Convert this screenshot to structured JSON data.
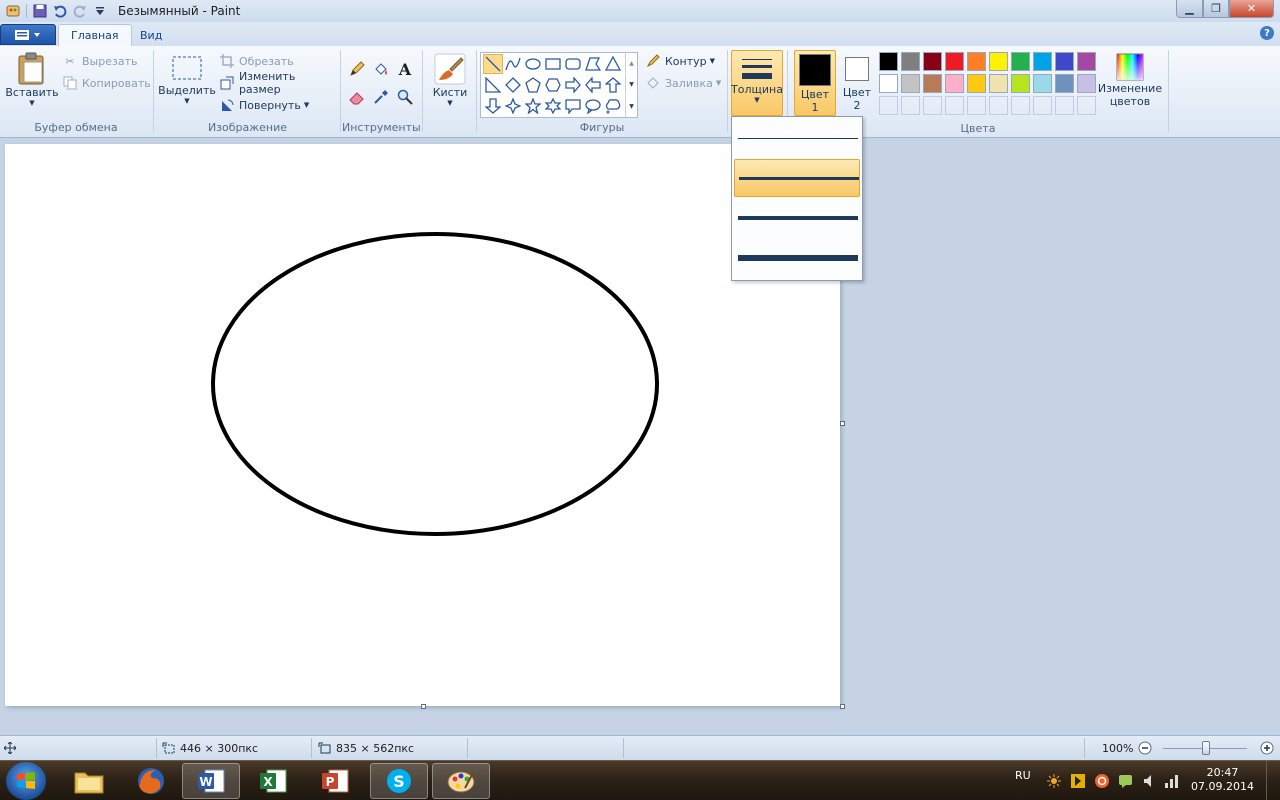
{
  "window": {
    "title": "Безымянный - Paint"
  },
  "tabs": {
    "home": "Главная",
    "view": "Вид"
  },
  "clipboard": {
    "paste": "Вставить",
    "cut": "Вырезать",
    "copy": "Копировать",
    "label": "Буфер обмена"
  },
  "image": {
    "select": "Выделить",
    "crop": "Обрезать",
    "resize": "Изменить размер",
    "rotate": "Повернуть",
    "label": "Изображение"
  },
  "tools": {
    "label": "Инструменты"
  },
  "brushes": {
    "label": "Кисти"
  },
  "shapes": {
    "outline": "Контур",
    "fill": "Заливка",
    "label": "Фигуры"
  },
  "thickness": {
    "label": "Толщина"
  },
  "colors": {
    "color1_line1": "Цвет",
    "color1_line2": "1",
    "color2_line1": "Цвет",
    "color2_line2": "2",
    "edit_line1": "Изменение",
    "edit_line2": "цветов",
    "label": "Цвета",
    "color1_value": "#000000",
    "color2_value": "#ffffff",
    "palette_row1": [
      "#000000",
      "#7f7f7f",
      "#880015",
      "#ed1c24",
      "#ff7f27",
      "#fff200",
      "#22b14c",
      "#00a2e8",
      "#3f48cc",
      "#a349a4"
    ],
    "palette_row2": [
      "#ffffff",
      "#c3c3c3",
      "#b97a57",
      "#ffaec9",
      "#ffc90e",
      "#efe4b0",
      "#b5e61d",
      "#99d9ea",
      "#7092be",
      "#c8bfe7"
    ]
  },
  "statusbar": {
    "selection_size": "446 × 300пкс",
    "canvas_size": "835 × 562пкс",
    "zoom": "100%"
  },
  "taskbar": {
    "language": "RU",
    "time": "20:47",
    "date": "07.09.2014"
  }
}
